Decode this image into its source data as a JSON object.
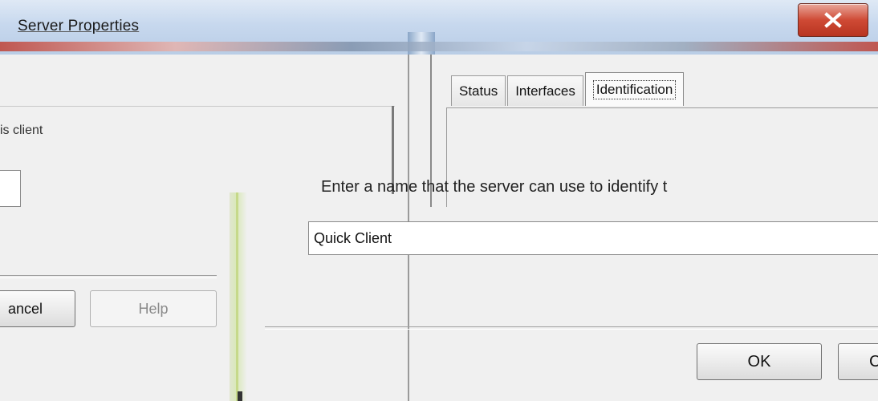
{
  "window": {
    "title": "Server Properties",
    "close_icon": "close-x-icon"
  },
  "left_dialog": {
    "text_fragment": "is client",
    "buttons": {
      "cancel_label": "ancel",
      "help_label": "Help"
    }
  },
  "right_dialog": {
    "tabs": [
      {
        "label": "Status",
        "active": false
      },
      {
        "label": "Interfaces",
        "active": false
      },
      {
        "label": "Identification",
        "active": true
      }
    ],
    "instruction": "Enter a name that the server can use to identify t",
    "name_field": {
      "value": "Quick Client"
    },
    "buttons": {
      "ok_label": "OK",
      "cancel_label": "C"
    }
  },
  "colors": {
    "close_button": "#cf4a35",
    "titlebar": "#c7d8ee"
  }
}
